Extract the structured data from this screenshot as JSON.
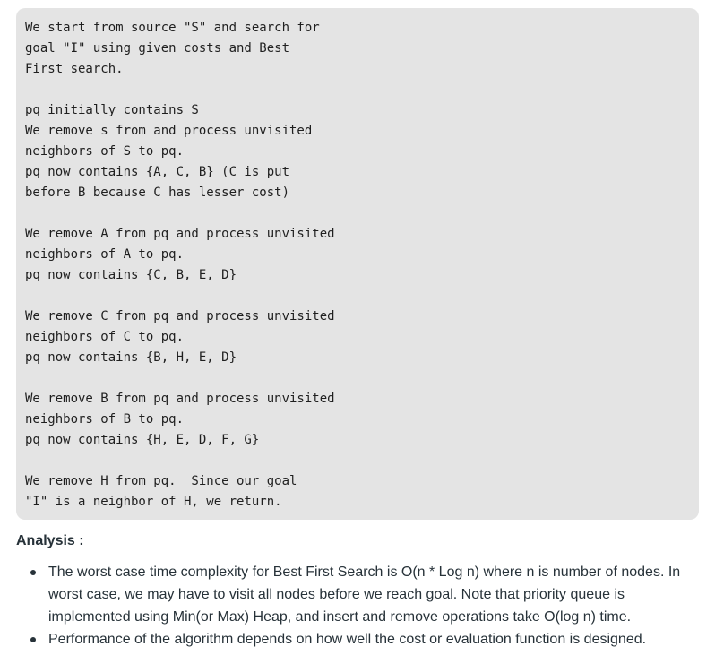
{
  "code_block": {
    "lines": [
      "We start from source \"S\" and search for",
      "goal \"I\" using given costs and Best",
      "First search.",
      "",
      "pq initially contains S",
      "We remove s from and process unvisited",
      "neighbors of S to pq.",
      "pq now contains {A, C, B} (C is put",
      "before B because C has lesser cost)",
      "",
      "We remove A from pq and process unvisited",
      "neighbors of A to pq.",
      "pq now contains {C, B, E, D}",
      "",
      "We remove C from pq and process unvisited",
      "neighbors of C to pq.",
      "pq now contains {B, H, E, D}",
      "",
      "We remove B from pq and process unvisited",
      "neighbors of B to pq.",
      "pq now contains {H, E, D, F, G}",
      "",
      "We remove H from pq.  Since our goal",
      "\"I\" is a neighbor of H, we return."
    ]
  },
  "analysis": {
    "heading": "Analysis :",
    "bullets": [
      "The worst case time complexity for Best First Search is O(n * Log n) where n is number of nodes. In worst case, we may have to visit all nodes before we reach goal. Note that priority queue is implemented using Min(or Max) Heap, and insert and remove operations take O(log n) time.",
      "Performance of the algorithm depends on how well the cost or evaluation function is designed."
    ]
  }
}
